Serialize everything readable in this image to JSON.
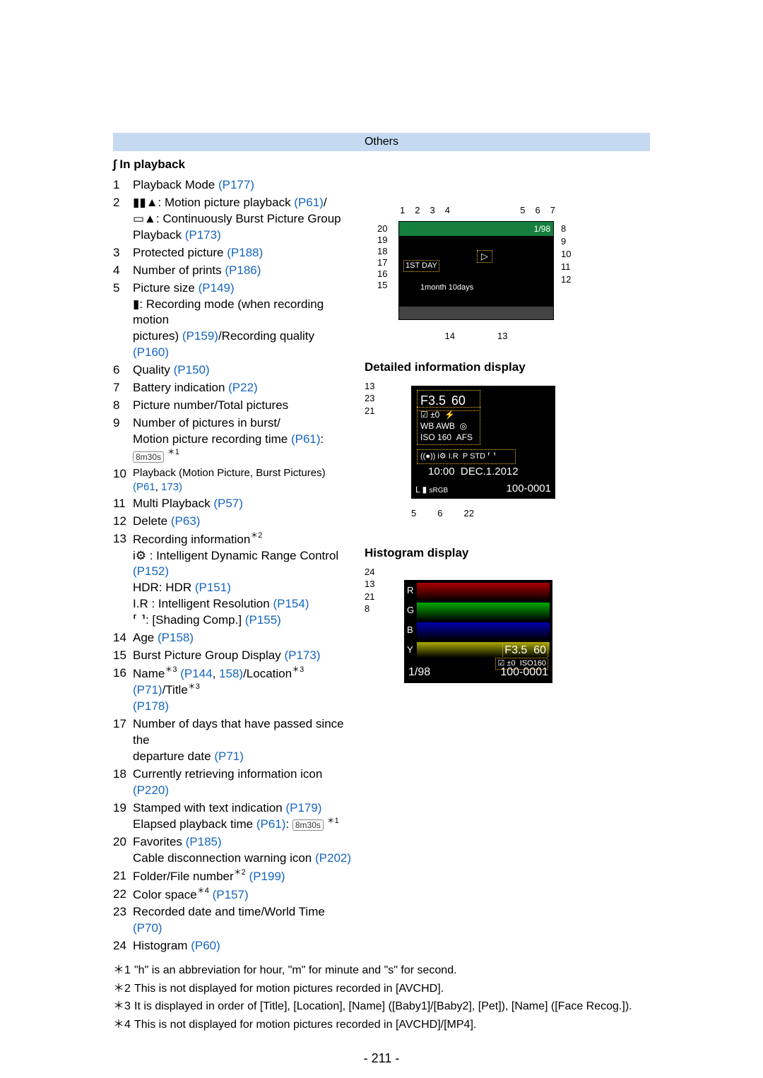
{
  "header": {
    "category": "Others"
  },
  "section_title": "In playback",
  "items": [
    {
      "n": "1",
      "parts": [
        {
          "t": "Playback Mode "
        },
        {
          "t": "(P177)",
          "link": true
        }
      ]
    },
    {
      "n": "2",
      "parts": [],
      "lines": [
        [
          {
            "t": "▮▮▲: Motion picture playback "
          },
          {
            "t": "(P61)",
            "link": true
          },
          {
            "t": "/"
          }
        ],
        [
          {
            "t": "▭▲: Continuously Burst Picture Group"
          }
        ],
        [
          {
            "t": "Playback "
          },
          {
            "t": "(P173)",
            "link": true
          }
        ]
      ]
    },
    {
      "n": "3",
      "parts": [
        {
          "t": "Protected picture "
        },
        {
          "t": "(P188)",
          "link": true
        }
      ]
    },
    {
      "n": "4",
      "parts": [
        {
          "t": "Number of prints "
        },
        {
          "t": "(P186)",
          "link": true
        }
      ]
    },
    {
      "n": "5",
      "parts": [],
      "lines": [
        [
          {
            "t": "Picture size "
          },
          {
            "t": "(P149)",
            "link": true
          }
        ],
        [
          {
            "t": "▮: Recording mode (when recording motion"
          }
        ],
        [
          {
            "t": "pictures) "
          },
          {
            "t": "(P159)",
            "link": true
          },
          {
            "t": "/Recording quality "
          },
          {
            "t": "(P160)",
            "link": true
          }
        ]
      ]
    },
    {
      "n": "6",
      "parts": [
        {
          "t": "Quality "
        },
        {
          "t": "(P150)",
          "link": true
        }
      ]
    },
    {
      "n": "7",
      "parts": [
        {
          "t": "Battery indication "
        },
        {
          "t": "(P22)",
          "link": true
        }
      ]
    },
    {
      "n": "8",
      "parts": [
        {
          "t": "Picture number/Total pictures"
        }
      ]
    },
    {
      "n": "9",
      "parts": [],
      "lines": [
        [
          {
            "t": "Number of pictures in burst/"
          }
        ],
        [
          {
            "t": "Motion picture recording time "
          },
          {
            "t": "(P61)",
            "link": true
          },
          {
            "t": ": "
          },
          {
            "t": "8m30s",
            "chip": true
          },
          {
            "t": " "
          },
          {
            "t": "＊1",
            "sup": true
          }
        ]
      ]
    },
    {
      "n": "10",
      "parts": [
        {
          "t": "Playback (Motion Picture, Burst Pictures) "
        },
        {
          "t": "(P61",
          "link": true
        },
        {
          "t": ", "
        },
        {
          "t": "173)",
          "link": true
        }
      ],
      "small": true
    },
    {
      "n": "11",
      "parts": [
        {
          "t": "Multi Playback "
        },
        {
          "t": "(P57)",
          "link": true
        }
      ]
    },
    {
      "n": "12",
      "parts": [
        {
          "t": "Delete "
        },
        {
          "t": "(P63)",
          "link": true
        }
      ]
    },
    {
      "n": "13",
      "parts": [],
      "lines": [
        [
          {
            "t": "Recording information"
          },
          {
            "t": "＊2",
            "sup": true
          }
        ],
        [
          {
            "t": "i⚙ : Intelligent Dynamic Range Control "
          },
          {
            "t": "(P152)",
            "link": true
          }
        ],
        [
          {
            "t": "HDR: HDR "
          },
          {
            "t": "(P151)",
            "link": true
          }
        ],
        [
          {
            "t": "I.R : Intelligent Resolution "
          },
          {
            "t": "(P154)",
            "link": true
          }
        ],
        [
          {
            "t": "⸢ ⸣: [Shading Comp.] "
          },
          {
            "t": "(P155)",
            "link": true
          }
        ]
      ]
    },
    {
      "n": "14",
      "parts": [
        {
          "t": "Age "
        },
        {
          "t": "(P158)",
          "link": true
        }
      ]
    },
    {
      "n": "15",
      "parts": [
        {
          "t": "Burst Picture Group Display "
        },
        {
          "t": "(P173)",
          "link": true
        }
      ]
    },
    {
      "n": "16",
      "parts": [],
      "lines": [
        [
          {
            "t": "Name"
          },
          {
            "t": "＊3",
            "sup": true
          },
          {
            "t": " "
          },
          {
            "t": "(P144",
            "link": true
          },
          {
            "t": ", "
          },
          {
            "t": "158)",
            "link": true
          },
          {
            "t": "/Location"
          },
          {
            "t": "＊3",
            "sup": true
          },
          {
            "t": " "
          },
          {
            "t": "(P71)",
            "link": true
          },
          {
            "t": "/Title"
          },
          {
            "t": "＊3",
            "sup": true
          }
        ],
        [
          {
            "t": "(P178)",
            "link": true
          }
        ]
      ]
    },
    {
      "n": "17",
      "parts": [],
      "lines": [
        [
          {
            "t": "Number of days that have passed since the"
          }
        ],
        [
          {
            "t": "departure date "
          },
          {
            "t": "(P71)",
            "link": true
          }
        ]
      ]
    },
    {
      "n": "18",
      "parts": [
        {
          "t": "Currently retrieving information icon "
        },
        {
          "t": "(P220)",
          "link": true
        }
      ]
    },
    {
      "n": "19",
      "parts": [],
      "lines": [
        [
          {
            "t": "Stamped with text indication "
          },
          {
            "t": "(P179)",
            "link": true
          }
        ],
        [
          {
            "t": "Elapsed playback time "
          },
          {
            "t": "(P61)",
            "link": true
          },
          {
            "t": ": "
          },
          {
            "t": "8m30s",
            "chip": true
          },
          {
            "t": " "
          },
          {
            "t": "＊1",
            "sup": true
          }
        ]
      ]
    },
    {
      "n": "20",
      "parts": [],
      "lines": [
        [
          {
            "t": "Favorites "
          },
          {
            "t": "(P185)",
            "link": true
          }
        ],
        [
          {
            "t": "Cable disconnection warning icon "
          },
          {
            "t": "(P202)",
            "link": true
          }
        ]
      ]
    },
    {
      "n": "21",
      "parts": [
        {
          "t": "Folder/File number"
        },
        {
          "t": "＊2",
          "sup": true
        },
        {
          "t": " "
        },
        {
          "t": "(P199)",
          "link": true
        }
      ]
    },
    {
      "n": "22",
      "parts": [
        {
          "t": "Color space"
        },
        {
          "t": "＊4",
          "sup": true
        },
        {
          "t": " "
        },
        {
          "t": "(P157)",
          "link": true
        }
      ]
    },
    {
      "n": "23",
      "parts": [
        {
          "t": "Recorded date and time/World Time "
        },
        {
          "t": "(P70)",
          "link": true
        }
      ]
    },
    {
      "n": "24",
      "parts": [
        {
          "t": "Histogram "
        },
        {
          "t": "(P60)",
          "link": true
        }
      ]
    }
  ],
  "footnotes": [
    {
      "n": "＊1",
      "text": "\"h\" is an abbreviation for hour, \"m\" for minute and \"s\" for second."
    },
    {
      "n": "＊2",
      "text": "This is not displayed for motion pictures recorded in [AVCHD]."
    },
    {
      "n": "＊3",
      "text": "It is displayed in order of [Title], [Location], [Name] ([Baby1]/[Baby2], [Pet]), [Name] ([Face Recog.])."
    },
    {
      "n": "＊4",
      "text": "This is not displayed for motion pictures recorded in [AVCHD]/[MP4]."
    }
  ],
  "page_number": "- 211 -",
  "diagrams": {
    "main": {
      "top_labels": [
        "1",
        "2",
        "3",
        "4",
        "5",
        "6",
        "7"
      ],
      "right_labels": [
        "8",
        "9",
        "10",
        "11",
        "12"
      ],
      "left_labels": [
        "20",
        "19",
        "18",
        "17",
        "16",
        "15"
      ],
      "bottom_labels": [
        "14",
        "13"
      ],
      "text_day": "1ST DAY",
      "text_age": "1month 10days",
      "count": "1/98"
    },
    "detail_title": "Detailed information display",
    "detail": {
      "top_label": "13",
      "left_label": "23",
      "right_labels": [
        "21"
      ],
      "bottom_labels": [
        "5",
        "6",
        "22"
      ],
      "f": "F3.5",
      "s": "60",
      "ev": "±0",
      "wb": "AWB",
      "iso": "160",
      "af": "AFS",
      "mode": "P",
      "std": "STD",
      "time": "10:00",
      "date": "DEC.1.2012",
      "rgb": "sRGB",
      "folder": "100-0001",
      "qual": "L"
    },
    "hist_title": "Histogram display",
    "hist": {
      "top_label": "24",
      "right_labels": [
        "13",
        "21"
      ],
      "bottom_label": "8",
      "letters": [
        "R",
        "G",
        "B",
        "Y"
      ],
      "f": "F3.5",
      "s": "60",
      "ev": "±0",
      "iso": "ISO160",
      "pic": "1/98",
      "folder": "100-0001"
    }
  }
}
